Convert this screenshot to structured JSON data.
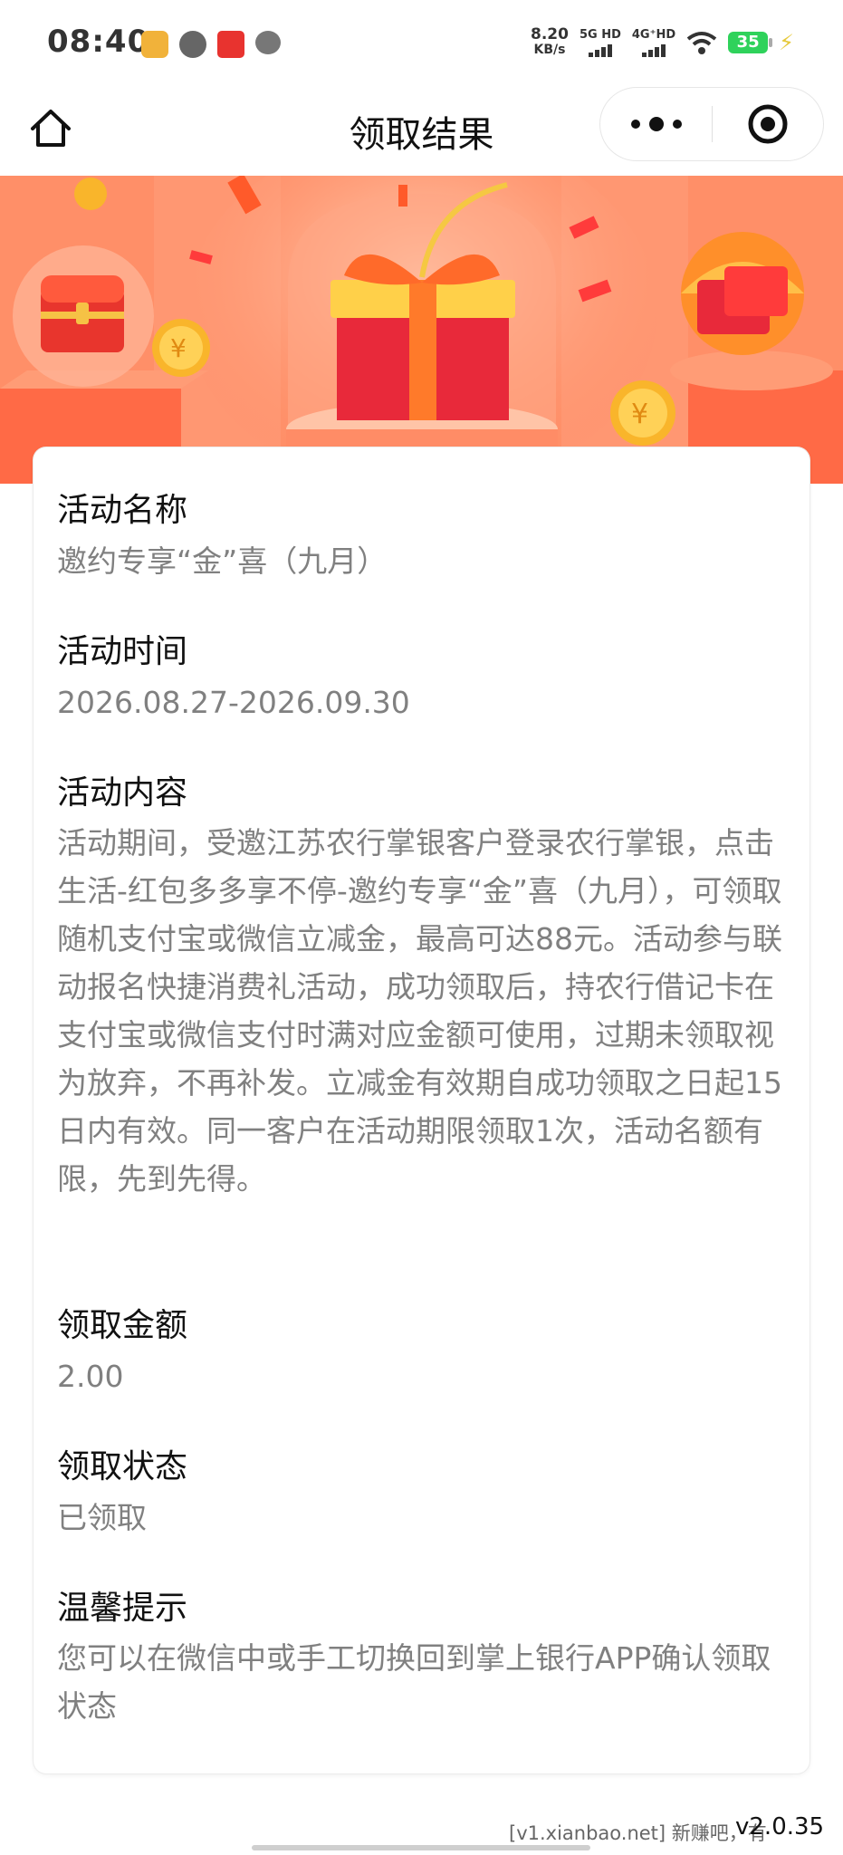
{
  "status_bar": {
    "time": "08:40",
    "speed_top": "8.20",
    "speed_bottom": "KB/s",
    "net1": "5G HD",
    "net2": "4G⁺HD",
    "battery": "35"
  },
  "nav": {
    "title": "领取结果"
  },
  "sections": [
    {
      "label": "活动名称",
      "value": "邀约专享“金”喜（九月）"
    },
    {
      "label": "活动时间",
      "value": "2026.08.27-2026.09.30"
    },
    {
      "label": "活动内容",
      "value": "活动期间，受邀江苏农行掌银客户登录农行掌银，点击生活-红包多多享不停-邀约专享“金”喜（九月），可领取随机支付宝或微信立减金，最高可达88元。活动参与联动报名快捷消费礼活动，成功领取后，持农行借记卡在支付宝或微信支付时满对应金额可使用，过期未领取视为放弃，不再补发。立减金有效期自成功领取之日起15日内有效。同一客户在活动期限领取1次，活动名额有限，先到先得。"
    },
    {
      "label": "领取金额",
      "value": "2.00"
    },
    {
      "label": "领取状态",
      "value": "已领取"
    },
    {
      "label": "温馨提示",
      "value": "您可以在微信中或手工切换回到掌上银行APP确认领取状态"
    }
  ],
  "footer": {
    "watermark": "[v1.xianbao.net] 新赚吧，有",
    "version": "v2.0.35"
  },
  "colors": {
    "banner": "#ff8a63",
    "label": "#111111",
    "value": "#808080",
    "battery": "#2fd25b"
  }
}
